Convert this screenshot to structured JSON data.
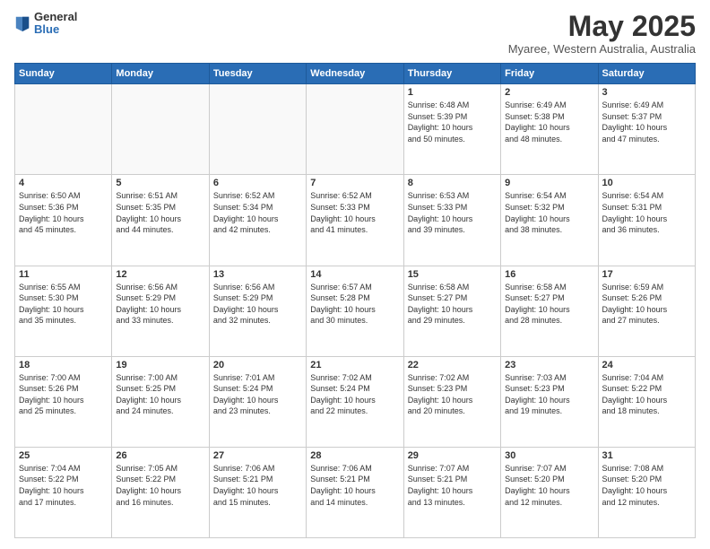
{
  "header": {
    "logo": {
      "line1": "General",
      "line2": "Blue"
    },
    "title": "May 2025",
    "location": "Myaree, Western Australia, Australia"
  },
  "days_of_week": [
    "Sunday",
    "Monday",
    "Tuesday",
    "Wednesday",
    "Thursday",
    "Friday",
    "Saturday"
  ],
  "weeks": [
    [
      {
        "day": "",
        "info": ""
      },
      {
        "day": "",
        "info": ""
      },
      {
        "day": "",
        "info": ""
      },
      {
        "day": "",
        "info": ""
      },
      {
        "day": "1",
        "info": "Sunrise: 6:48 AM\nSunset: 5:39 PM\nDaylight: 10 hours\nand 50 minutes."
      },
      {
        "day": "2",
        "info": "Sunrise: 6:49 AM\nSunset: 5:38 PM\nDaylight: 10 hours\nand 48 minutes."
      },
      {
        "day": "3",
        "info": "Sunrise: 6:49 AM\nSunset: 5:37 PM\nDaylight: 10 hours\nand 47 minutes."
      }
    ],
    [
      {
        "day": "4",
        "info": "Sunrise: 6:50 AM\nSunset: 5:36 PM\nDaylight: 10 hours\nand 45 minutes."
      },
      {
        "day": "5",
        "info": "Sunrise: 6:51 AM\nSunset: 5:35 PM\nDaylight: 10 hours\nand 44 minutes."
      },
      {
        "day": "6",
        "info": "Sunrise: 6:52 AM\nSunset: 5:34 PM\nDaylight: 10 hours\nand 42 minutes."
      },
      {
        "day": "7",
        "info": "Sunrise: 6:52 AM\nSunset: 5:33 PM\nDaylight: 10 hours\nand 41 minutes."
      },
      {
        "day": "8",
        "info": "Sunrise: 6:53 AM\nSunset: 5:33 PM\nDaylight: 10 hours\nand 39 minutes."
      },
      {
        "day": "9",
        "info": "Sunrise: 6:54 AM\nSunset: 5:32 PM\nDaylight: 10 hours\nand 38 minutes."
      },
      {
        "day": "10",
        "info": "Sunrise: 6:54 AM\nSunset: 5:31 PM\nDaylight: 10 hours\nand 36 minutes."
      }
    ],
    [
      {
        "day": "11",
        "info": "Sunrise: 6:55 AM\nSunset: 5:30 PM\nDaylight: 10 hours\nand 35 minutes."
      },
      {
        "day": "12",
        "info": "Sunrise: 6:56 AM\nSunset: 5:29 PM\nDaylight: 10 hours\nand 33 minutes."
      },
      {
        "day": "13",
        "info": "Sunrise: 6:56 AM\nSunset: 5:29 PM\nDaylight: 10 hours\nand 32 minutes."
      },
      {
        "day": "14",
        "info": "Sunrise: 6:57 AM\nSunset: 5:28 PM\nDaylight: 10 hours\nand 30 minutes."
      },
      {
        "day": "15",
        "info": "Sunrise: 6:58 AM\nSunset: 5:27 PM\nDaylight: 10 hours\nand 29 minutes."
      },
      {
        "day": "16",
        "info": "Sunrise: 6:58 AM\nSunset: 5:27 PM\nDaylight: 10 hours\nand 28 minutes."
      },
      {
        "day": "17",
        "info": "Sunrise: 6:59 AM\nSunset: 5:26 PM\nDaylight: 10 hours\nand 27 minutes."
      }
    ],
    [
      {
        "day": "18",
        "info": "Sunrise: 7:00 AM\nSunset: 5:26 PM\nDaylight: 10 hours\nand 25 minutes."
      },
      {
        "day": "19",
        "info": "Sunrise: 7:00 AM\nSunset: 5:25 PM\nDaylight: 10 hours\nand 24 minutes."
      },
      {
        "day": "20",
        "info": "Sunrise: 7:01 AM\nSunset: 5:24 PM\nDaylight: 10 hours\nand 23 minutes."
      },
      {
        "day": "21",
        "info": "Sunrise: 7:02 AM\nSunset: 5:24 PM\nDaylight: 10 hours\nand 22 minutes."
      },
      {
        "day": "22",
        "info": "Sunrise: 7:02 AM\nSunset: 5:23 PM\nDaylight: 10 hours\nand 20 minutes."
      },
      {
        "day": "23",
        "info": "Sunrise: 7:03 AM\nSunset: 5:23 PM\nDaylight: 10 hours\nand 19 minutes."
      },
      {
        "day": "24",
        "info": "Sunrise: 7:04 AM\nSunset: 5:22 PM\nDaylight: 10 hours\nand 18 minutes."
      }
    ],
    [
      {
        "day": "25",
        "info": "Sunrise: 7:04 AM\nSunset: 5:22 PM\nDaylight: 10 hours\nand 17 minutes."
      },
      {
        "day": "26",
        "info": "Sunrise: 7:05 AM\nSunset: 5:22 PM\nDaylight: 10 hours\nand 16 minutes."
      },
      {
        "day": "27",
        "info": "Sunrise: 7:06 AM\nSunset: 5:21 PM\nDaylight: 10 hours\nand 15 minutes."
      },
      {
        "day": "28",
        "info": "Sunrise: 7:06 AM\nSunset: 5:21 PM\nDaylight: 10 hours\nand 14 minutes."
      },
      {
        "day": "29",
        "info": "Sunrise: 7:07 AM\nSunset: 5:21 PM\nDaylight: 10 hours\nand 13 minutes."
      },
      {
        "day": "30",
        "info": "Sunrise: 7:07 AM\nSunset: 5:20 PM\nDaylight: 10 hours\nand 12 minutes."
      },
      {
        "day": "31",
        "info": "Sunrise: 7:08 AM\nSunset: 5:20 PM\nDaylight: 10 hours\nand 12 minutes."
      }
    ]
  ]
}
